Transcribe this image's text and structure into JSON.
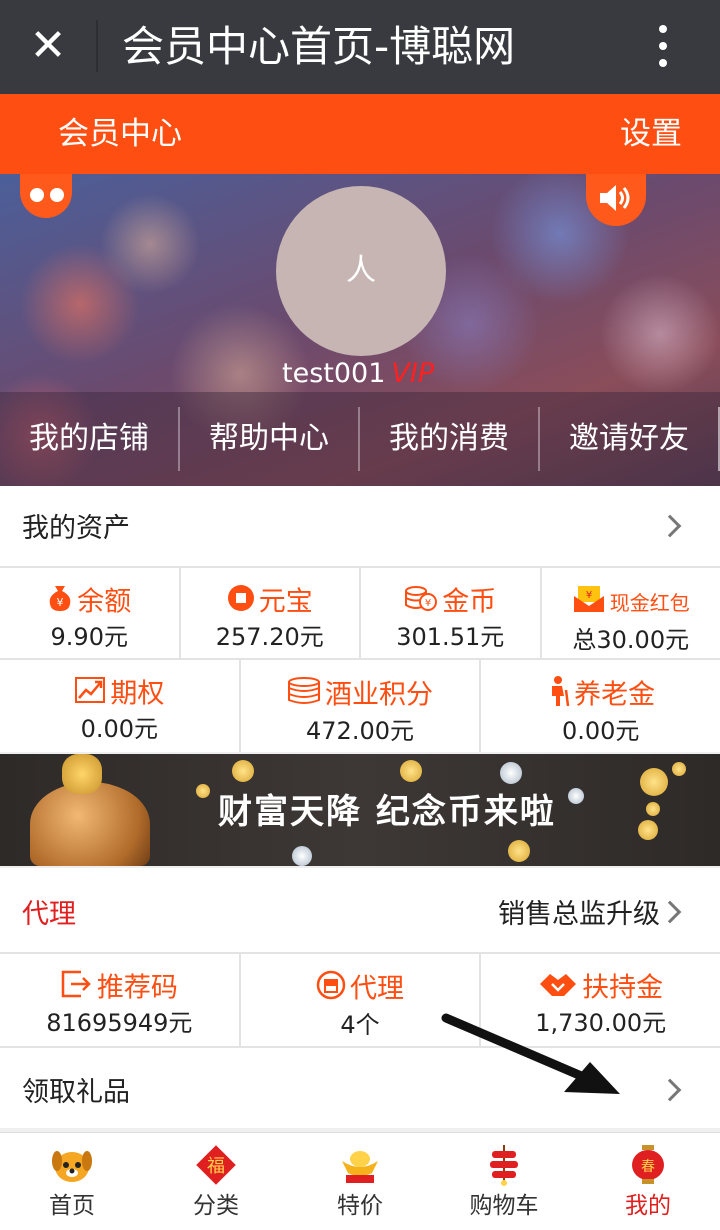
{
  "window": {
    "title": "会员中心首页-博聪网"
  },
  "header": {
    "title": "会员中心",
    "settings": "设置"
  },
  "profile": {
    "avatar_text": "人",
    "username": "test001",
    "badge": "VIP"
  },
  "quicknav": [
    "我的店铺",
    "帮助中心",
    "我的消费",
    "邀请好友"
  ],
  "assets": {
    "title": "我的资产",
    "row1": [
      {
        "label": "余额",
        "value": "9.90元",
        "icon": "money-bag-icon"
      },
      {
        "label": "元宝",
        "value": "257.20元",
        "icon": "ingot-icon"
      },
      {
        "label": "金币",
        "value": "301.51元",
        "icon": "gold-coin-icon"
      },
      {
        "label": "现金红包",
        "value": "总30.00元",
        "icon": "red-envelope-icon"
      }
    ],
    "row2": [
      {
        "label": "期权",
        "value": "0.00元",
        "icon": "chart-up-icon"
      },
      {
        "label": "酒业积分",
        "value": "472.00元",
        "icon": "coin-stack-icon"
      },
      {
        "label": "养老金",
        "value": "0.00元",
        "icon": "elder-icon"
      }
    ]
  },
  "ad": {
    "text": "财富天降 纪念币来啦"
  },
  "agent": {
    "title": "代理",
    "upgrade": "销售总监升级",
    "cells": [
      {
        "label": "推荐码",
        "value": "81695949元",
        "icon": "share-icon"
      },
      {
        "label": "代理",
        "value": "4个",
        "icon": "shop-icon"
      },
      {
        "label": "扶持金",
        "value": "1,730.00元",
        "icon": "handshake-icon"
      }
    ]
  },
  "gift": {
    "title": "领取礼品"
  },
  "tabbar": [
    {
      "label": "首页",
      "icon": "dog-icon"
    },
    {
      "label": "分类",
      "icon": "fu-icon"
    },
    {
      "label": "特价",
      "icon": "ingot-icon"
    },
    {
      "label": "购物车",
      "icon": "firecracker-icon"
    },
    {
      "label": "我的",
      "icon": "lantern-icon"
    }
  ],
  "colors": {
    "accent": "#ff4e11",
    "titlebar": "#393a3f",
    "active_tab": "#e02020"
  }
}
